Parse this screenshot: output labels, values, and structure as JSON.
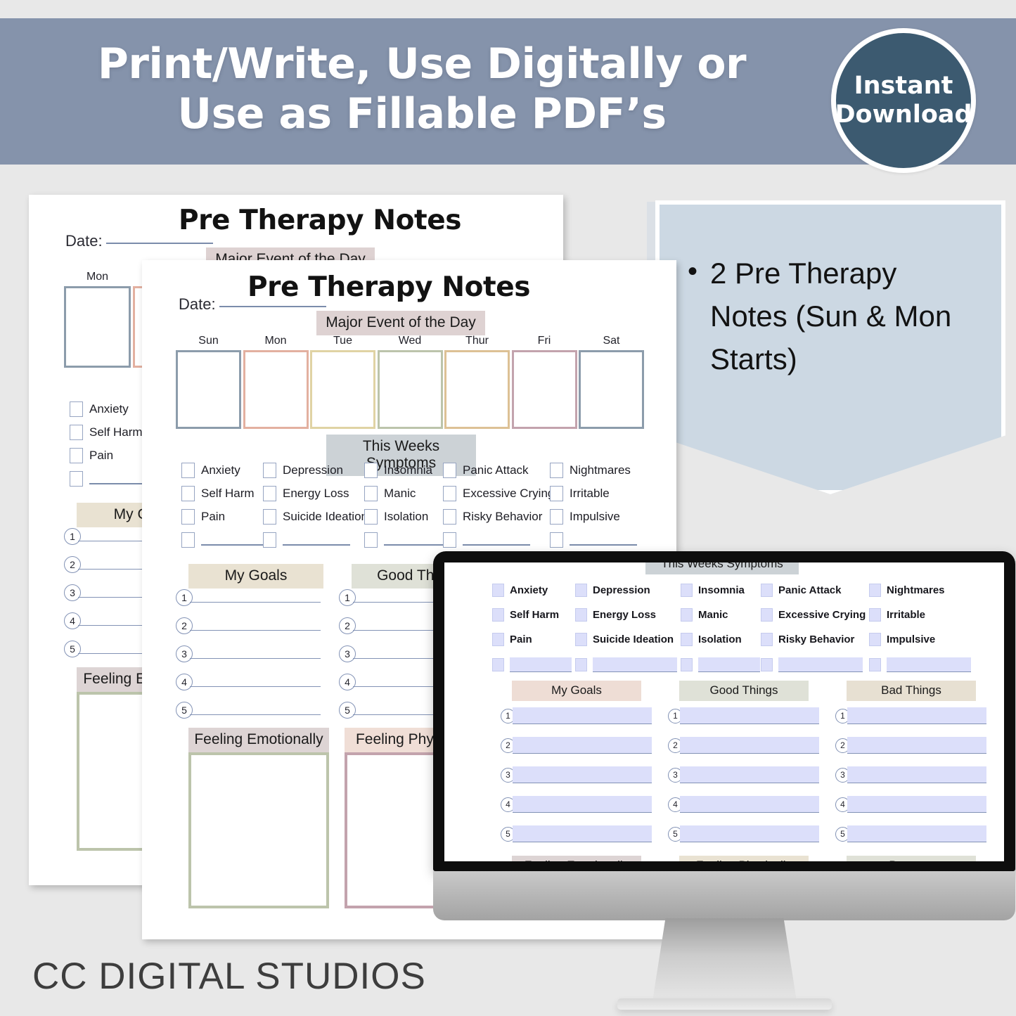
{
  "banner": {
    "headline_line1": "Print/Write, Use Digitally or",
    "headline_line2": "Use as Fillable PDF’s",
    "badge_line1": "Instant",
    "badge_line2": "Download",
    "bg_color": "#8593ab",
    "badge_color": "#3c5a70"
  },
  "info_panel": {
    "bg_color": "#ccd8e3",
    "bullets": [
      "2 Pre Therapy Notes (Sun & Mon Starts)"
    ],
    "bullet_lines": [
      "2 Pre Therapy",
      "Notes (Sun &",
      "Mon Starts)"
    ]
  },
  "footer": {
    "brand": "CC DIGITAL STUDIOS"
  },
  "worksheet": {
    "title": "Pre Therapy Notes",
    "date_label": "Date:",
    "major_event_header": "Major Event of the Day",
    "symptoms_header": "This Weeks Symptoms",
    "days_sun_start": [
      "Sun",
      "Mon",
      "Tue",
      "Wed",
      "Thur",
      "Fri",
      "Sat"
    ],
    "days_mon_start": [
      "Mon",
      "Tue",
      "Wed",
      "Thur",
      "Fri",
      "Sat",
      "Sun"
    ],
    "day_colors": [
      "#8c9cab",
      "#e3b0a0",
      "#e0d3a4",
      "#bcc4ab",
      "#ddc195",
      "#c3a3ad",
      "#8c9cab"
    ],
    "symptoms_columns": [
      [
        "Anxiety",
        "Self Harm",
        "Pain"
      ],
      [
        "Depression",
        "Energy Loss",
        "Suicide Ideation"
      ],
      [
        "Insomnia",
        "Manic",
        "Isolation"
      ],
      [
        "Panic Attack",
        "Excessive Crying",
        "Risky Behavior"
      ],
      [
        "Nightmares",
        "Irritable",
        "Impulsive"
      ]
    ],
    "list_sections": [
      {
        "label": "My Goals",
        "color": "#e9e2d2"
      },
      {
        "label": "Good Things",
        "color": "#dfe1d7"
      },
      {
        "label": "Bad Things",
        "color": "#e7e0d2"
      }
    ],
    "list_numbers": [
      "1",
      "2",
      "3",
      "4",
      "5"
    ],
    "box_sections": [
      {
        "label": "Feeling Emotionally",
        "header_color": "#ddd4d4",
        "border_color": "#bcc4ab"
      },
      {
        "label": "Feeling Physically",
        "header_color": "#f0ded6",
        "border_color": "#c3a3ad"
      },
      {
        "label": "Patterns",
        "header_color": "#dfe1d7",
        "border_color": "#bcc4ab"
      }
    ],
    "major_event_color": "#ded2d2",
    "symptoms_header_color": "#ccd2d6"
  },
  "monitor": {
    "screen_list_sections": [
      {
        "label": "My Goals",
        "color": "#eeddd5"
      },
      {
        "label": "Good Things",
        "color": "#dfe1d7"
      },
      {
        "label": "Bad Things",
        "color": "#e7e0d2"
      }
    ],
    "screen_box_sections": [
      {
        "label": "Feeling Emotionally",
        "color": "#ddd4d4"
      },
      {
        "label": "Feeling Physically",
        "color": "#e9e2d2"
      },
      {
        "label": "Patterns",
        "color": "#dfe1d7"
      }
    ],
    "field_color": "#dcdffa"
  }
}
